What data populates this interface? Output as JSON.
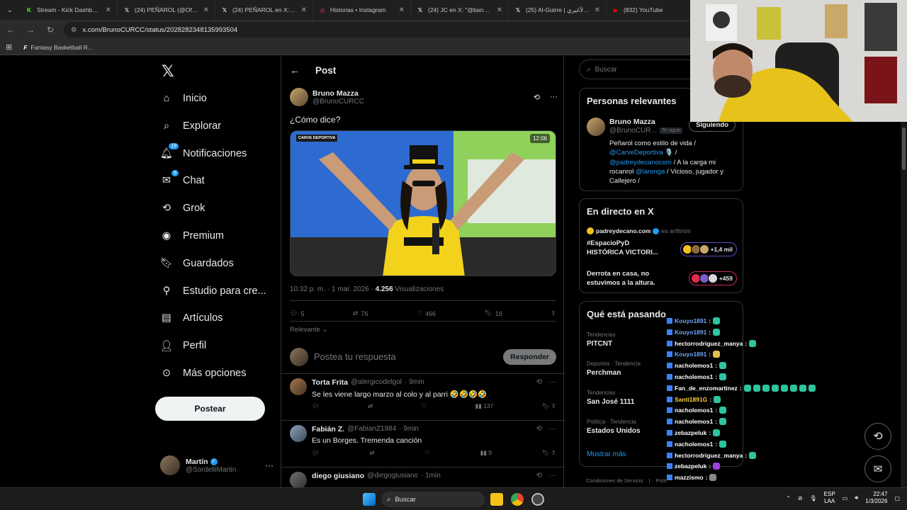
{
  "browser": {
    "tabs": [
      {
        "title": "Stream - Kick Dashboard",
        "color": "#53fc18",
        "glyph": "K"
      },
      {
        "title": "(24) PEÑAROL (@OficialC",
        "color": "#ffffff",
        "glyph": "𝕏"
      },
      {
        "title": "(24) PEÑAROL en X: \"No",
        "color": "#ffffff",
        "glyph": "𝕏"
      },
      {
        "title": "Historias • Instagram",
        "color": "#e1306c",
        "glyph": "◎"
      },
      {
        "title": "(24) JC en X: \"@banewur",
        "color": "#ffffff",
        "glyph": "𝕏"
      },
      {
        "title": "(25) Al-Guirre | الأغيري en",
        "color": "#ffffff",
        "glyph": "𝕏"
      },
      {
        "title": "(832) YouTube",
        "color": "#ff0000",
        "glyph": "▶"
      }
    ],
    "url": "x.com/BrunoCURCC/status/2028282348135993504",
    "bookmark": "Fantasy Basketball R..."
  },
  "nav": {
    "items": [
      {
        "label": "Inicio",
        "icon": "home-icon",
        "badge": ""
      },
      {
        "label": "Explorar",
        "icon": "search-icon",
        "badge": ""
      },
      {
        "label": "Notificaciones",
        "icon": "bell-icon",
        "badge": "19"
      },
      {
        "label": "Chat",
        "icon": "mail-icon",
        "badge": "6"
      },
      {
        "label": "Grok",
        "icon": "grok-icon",
        "badge": ""
      },
      {
        "label": "Premium",
        "icon": "verified-icon",
        "badge": ""
      },
      {
        "label": "Guardados",
        "icon": "bookmark-icon",
        "badge": ""
      },
      {
        "label": "Estudio para cre...",
        "icon": "studio-icon",
        "badge": ""
      },
      {
        "label": "Artículos",
        "icon": "article-icon",
        "badge": ""
      },
      {
        "label": "Perfil",
        "icon": "person-icon",
        "badge": ""
      },
      {
        "label": "Más opciones",
        "icon": "more-circle-icon",
        "badge": ""
      }
    ],
    "post_button": "Postear",
    "account": {
      "name": "Martín",
      "handle": "@SordelliMartin"
    }
  },
  "post": {
    "header": "Post",
    "author_name": "Bruno Mazza",
    "author_handle": "@BrunoCURCC",
    "text": "¿Cómo dice?",
    "video_duration": "12:06",
    "video_logo": "CARVE DEPORTIVA",
    "timestamp": "10:32 p. m. · 1 mar. 2026 · ",
    "views_count": "4.256",
    "views_label": " Visualizaciones",
    "replies": "5",
    "reposts": "76",
    "likes": "466",
    "bookmarks": "16",
    "sort_label": "Relevante",
    "reply_placeholder": "Postea tu respuesta",
    "reply_button": "Responder"
  },
  "replies": [
    {
      "name": "Torta Frita",
      "handle": "@alergicodelgol",
      "time": "· 9min",
      "text": "Se les viene largo marzo al colo y al parri 🤣🤣🤣🤣",
      "views": "137"
    },
    {
      "name": "Fabián Z.",
      "handle": "@FabianZ1984",
      "time": "· 9min",
      "text": "Es un Borges. Tremenda canción",
      "views": "9"
    },
    {
      "name": "diego giusiano",
      "handle": "@diegogiusiano",
      "time": "· 1min",
      "text": "",
      "views": ""
    }
  ],
  "sidebar": {
    "search_placeholder": "Buscar",
    "relevant": {
      "title": "Personas relevantes",
      "name": "Bruno Mazza",
      "handle": "@BrunoCUR...",
      "follows_you": "Te sigue",
      "following": "Siguiendo",
      "bio_1": "Peñarol como estilo de vida / ",
      "bio_link_1": "@CarveDeportiva",
      "bio_2": " 🎙️ / ",
      "bio_link_2": "@padreydecanocom",
      "bio_3": " / A la carga mi rocanrol ",
      "bio_link_3": "@larenga",
      "bio_4": " / Vicioso, jugador y Callejero /"
    },
    "live": {
      "title": "En directo en X",
      "host": "padreydecano.com",
      "host_suffix": "es anfitrión",
      "item1": "#EspacioPyD HISTÓRICA VICTORI...",
      "item1_count": "+1,4 mil",
      "item2": "Derrota en casa, no estuvimos a la altura.",
      "item2_count": "+459"
    },
    "trends": {
      "title": "Qué está pasando",
      "items": [
        {
          "category": "Tendencias",
          "name": "PITCNT"
        },
        {
          "category": "Deportes · Tendencia",
          "name": "Perchman"
        },
        {
          "category": "Tendencias",
          "name": "San José 1111"
        },
        {
          "category": "Política · Tendencia",
          "name": "Estados Unidos"
        }
      ],
      "show_more": "Mostrar más"
    },
    "footer": [
      "Condiciones de Servicio",
      "|",
      "Polít"
    ]
  },
  "chat": [
    {
      "user": "Kouyo1891",
      "color": "#6fa8ff"
    },
    {
      "user": "Kouyo1891",
      "color": "#6fa8ff"
    },
    {
      "user": "hectorrodriguez_manya",
      "color": "#ffffff"
    },
    {
      "user": "Kouyo1891",
      "color": "#6fa8ff"
    },
    {
      "user": "nacholemos1",
      "color": "#ffffff"
    },
    {
      "user": "nacholemos1",
      "color": "#ffffff"
    },
    {
      "user": "Fan_de_enzomartinez",
      "color": "#ffffff"
    },
    {
      "user": "Santi1891G",
      "color": "#ffd23f"
    },
    {
      "user": "nacholemos1",
      "color": "#ffffff"
    },
    {
      "user": "nacholemos1",
      "color": "#ffffff"
    },
    {
      "user": "zebazpeluk",
      "color": "#ffffff"
    },
    {
      "user": "nacholemos1",
      "color": "#ffffff"
    },
    {
      "user": "hectorrodriguez_manya",
      "color": "#ffffff"
    },
    {
      "user": "zebazpeluk",
      "color": "#ffffff"
    },
    {
      "user": "mazzismo",
      "color": "#ffffff"
    }
  ],
  "taskbar": {
    "search": "Buscar",
    "lang": "ESP",
    "lang2": "LAA",
    "time": "22:47",
    "date": "1/3/2026"
  },
  "colors": {
    "accent": "#1d9bf0",
    "bg": "#000000",
    "border": "#2f3336",
    "muted": "#71767b"
  }
}
